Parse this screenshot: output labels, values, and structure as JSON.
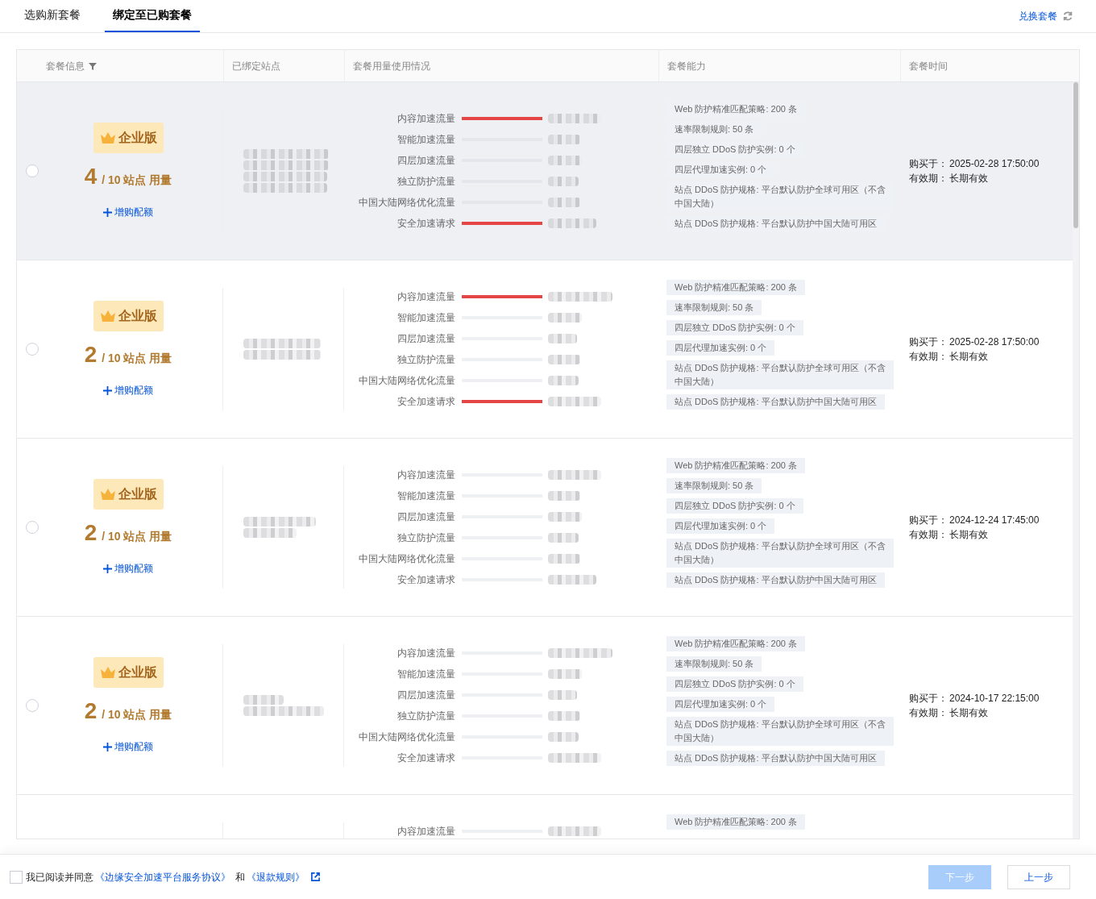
{
  "tabs": [
    {
      "label": "选购新套餐",
      "selected": false
    },
    {
      "label": "绑定至已购套餐",
      "selected": true
    }
  ],
  "redeem_link": "兑换套餐",
  "table": {
    "columns": [
      {
        "label": "套餐信息",
        "filter": true
      },
      {
        "label": "已绑定站点"
      },
      {
        "label": "套餐用量使用情况"
      },
      {
        "label": "套餐能力"
      },
      {
        "label": "套餐时间"
      }
    ],
    "rows": [
      {
        "hovered": true,
        "selected": false,
        "plan": {
          "edition": "企业版",
          "used": "4",
          "quota": "/ 10 站点 用量",
          "add_link": "增购配额"
        },
        "usage": [
          {
            "label": "内容加速流量",
            "level": 1
          },
          {
            "label": "智能加速流量",
            "level": 0
          },
          {
            "label": "四层加速流量",
            "level": 0
          },
          {
            "label": "独立防护流量",
            "level": 0
          },
          {
            "label": "中国大陆网络优化流量",
            "level": 0
          },
          {
            "label": "安全加速请求",
            "level": 1
          }
        ],
        "capabilities": [
          "Web 防护精准匹配策略: 200 条",
          "速率限制规则: 50 条",
          "四层独立 DDoS 防护实例: 0 个",
          "四层代理加速实例: 0 个",
          "站点 DDoS 防护规格: 平台默认防护全球可用区（不含中国大陆）",
          "站点 DDoS 防护规格: 平台默认防护中国大陆可用区"
        ],
        "time": {
          "purchased_label": "购买于：",
          "purchased": "2025-02-28 17:50:00",
          "validity_label": "有效期：",
          "validity": "长期有效"
        }
      },
      {
        "hovered": false,
        "selected": false,
        "plan": {
          "edition": "企业版",
          "used": "2",
          "quota": "/ 10 站点 用量",
          "add_link": "增购配额"
        },
        "usage": [
          {
            "label": "内容加速流量",
            "level": 1
          },
          {
            "label": "智能加速流量",
            "level": 0
          },
          {
            "label": "四层加速流量",
            "level": 0
          },
          {
            "label": "独立防护流量",
            "level": 0
          },
          {
            "label": "中国大陆网络优化流量",
            "level": 0
          },
          {
            "label": "安全加速请求",
            "level": 1
          }
        ],
        "capabilities": [
          "Web 防护精准匹配策略: 200 条",
          "速率限制规则: 50 条",
          "四层独立 DDoS 防护实例: 0 个",
          "四层代理加速实例: 0 个",
          "站点 DDoS 防护规格: 平台默认防护全球可用区（不含中国大陆）",
          "站点 DDoS 防护规格: 平台默认防护中国大陆可用区"
        ],
        "time": {
          "purchased_label": "购买于：",
          "purchased": "2025-02-28 17:50:00",
          "validity_label": "有效期：",
          "validity": "长期有效"
        }
      },
      {
        "hovered": false,
        "selected": false,
        "plan": {
          "edition": "企业版",
          "used": "2",
          "quota": "/ 10 站点 用量",
          "add_link": "增购配额"
        },
        "usage": [
          {
            "label": "内容加速流量",
            "level": 0
          },
          {
            "label": "智能加速流量",
            "level": 0
          },
          {
            "label": "四层加速流量",
            "level": 0
          },
          {
            "label": "独立防护流量",
            "level": 0
          },
          {
            "label": "中国大陆网络优化流量",
            "level": 0
          },
          {
            "label": "安全加速请求",
            "level": 0
          }
        ],
        "capabilities": [
          "Web 防护精准匹配策略: 200 条",
          "速率限制规则: 50 条",
          "四层独立 DDoS 防护实例: 0 个",
          "四层代理加速实例: 0 个",
          "站点 DDoS 防护规格: 平台默认防护全球可用区（不含中国大陆）",
          "站点 DDoS 防护规格: 平台默认防护中国大陆可用区"
        ],
        "time": {
          "purchased_label": "购买于：",
          "purchased": "2024-12-24 17:45:00",
          "validity_label": "有效期：",
          "validity": "长期有效"
        }
      },
      {
        "hovered": false,
        "selected": false,
        "plan": {
          "edition": "企业版",
          "used": "2",
          "quota": "/ 10 站点 用量",
          "add_link": "增购配额"
        },
        "usage": [
          {
            "label": "内容加速流量",
            "level": 0
          },
          {
            "label": "智能加速流量",
            "level": 0
          },
          {
            "label": "四层加速流量",
            "level": 0
          },
          {
            "label": "独立防护流量",
            "level": 0
          },
          {
            "label": "中国大陆网络优化流量",
            "level": 0
          },
          {
            "label": "安全加速请求",
            "level": 0
          }
        ],
        "capabilities": [
          "Web 防护精准匹配策略: 200 条",
          "速率限制规则: 50 条",
          "四层独立 DDoS 防护实例: 0 个",
          "四层代理加速实例: 0 个",
          "站点 DDoS 防护规格: 平台默认防护全球可用区（不含中国大陆）",
          "站点 DDoS 防护规格: 平台默认防护中国大陆可用区"
        ],
        "time": {
          "purchased_label": "购买于：",
          "purchased": "2024-10-17 22:15:00",
          "validity_label": "有效期：",
          "validity": "长期有效"
        }
      },
      {
        "hovered": false,
        "usage": [
          {
            "label": "内容加速流量",
            "level": 0
          }
        ],
        "capabilities": [
          "Web 防护精准匹配策略: 200 条"
        ]
      }
    ]
  },
  "footer": {
    "agree_checked": false,
    "agree_text": "我已阅读并同意",
    "agreement_link": "《边缘安全加速平台服务协议》",
    "and_text": "和",
    "refund_link": "《退款规则》",
    "next_button": {
      "label": "下一步",
      "disabled": true
    },
    "back_button": {
      "label": "上一步",
      "disabled": false
    }
  }
}
